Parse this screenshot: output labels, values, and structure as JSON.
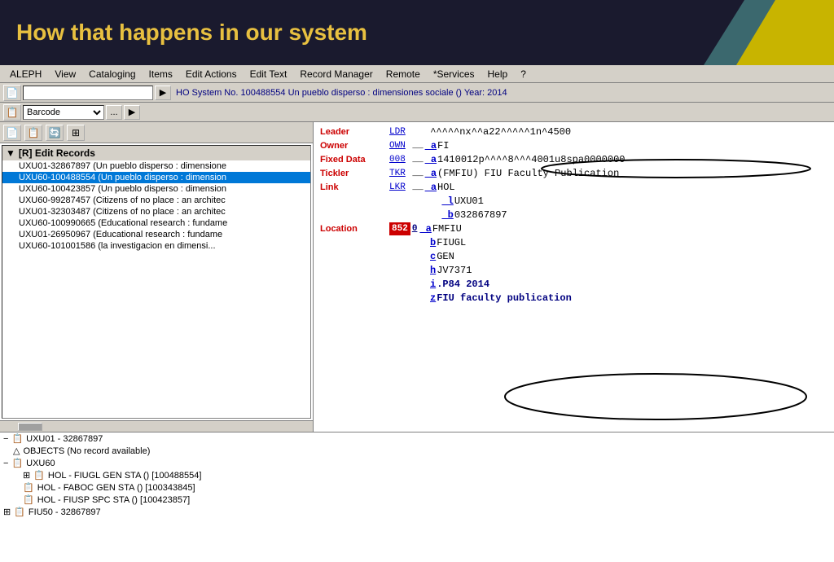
{
  "header": {
    "title": "How that happens in our system",
    "background_color": "#1a1a2e",
    "text_color": "#e8c040"
  },
  "menubar": {
    "items": [
      "ALEPH",
      "View",
      "Cataloging",
      "Items",
      "Edit Actions",
      "Edit Text",
      "Record Manager",
      "Remote",
      "*Services",
      "Help",
      "?"
    ]
  },
  "toolbar": {
    "nav_info": "HO System No. 100488554 Un pueblo disperso : dimensiones sociale () Year: 2014",
    "barcode_label": "Barcode"
  },
  "left_panel": {
    "tree_header": "[R] Edit Records",
    "tree_items": [
      "UXU01-32867897 (Un pueblo disperso : dimensione",
      "UXU60-100488554 (Un pueblo disperso : dimension",
      "UXU60-100423857 (Un pueblo disperso : dimension",
      "UXU60-99287457 (Citizens of no place : an architec",
      "UXU01-32303487 (Citizens of no place : an architec",
      "UXU60-100990665 (Educational research : fundame",
      "UXU01-26950967 (Educational research : fundame",
      "UXU60-101001586 (la investigacion en dimensi..."
    ]
  },
  "bottom_tree": {
    "items": [
      {
        "level": 0,
        "icon": "minus",
        "type": "book",
        "label": "UXU01 - 32867897"
      },
      {
        "level": 1,
        "icon": "triangle",
        "type": "objects",
        "label": "OBJECTS (No record available)"
      },
      {
        "level": 0,
        "icon": "minus",
        "type": "book",
        "label": "UXU60"
      },
      {
        "level": 1,
        "icon": "plus",
        "type": "book",
        "label": "HOL - FIUGL GEN STA () [100488554]"
      },
      {
        "level": 1,
        "icon": "plus",
        "type": "book",
        "label": "HOL - FABOC GEN STA () [100343845]"
      },
      {
        "level": 1,
        "icon": "plus",
        "type": "book",
        "label": "HOL - FIUSP SPC STA () [100423857]"
      },
      {
        "level": 0,
        "icon": "plus",
        "type": "book",
        "label": "FIU50 - 32867897"
      }
    ]
  },
  "right_panel": {
    "fields": [
      {
        "label": "Leader",
        "tag": "LDR",
        "ind": "",
        "subfields": [],
        "value": "^^^^^nx^^a22^^^^^1n^4500"
      },
      {
        "label": "Owner",
        "tag": "OWN",
        "ind": "__ a",
        "value": "FI"
      },
      {
        "label": "Fixed Data",
        "tag": "008",
        "ind": "__ a",
        "value": "1410012p^^^^8^^^4001u8spa0000000"
      },
      {
        "label": "Tickler",
        "tag": "TKR",
        "ind": "__ a",
        "value": "(FMFIU) FIU Faculty Publication",
        "oval": true
      },
      {
        "label": "Link",
        "tag": "LKR",
        "ind": "__ a",
        "value": "HOL",
        "sublines": [
          {
            "sub": "l",
            "val": "UXU01"
          },
          {
            "sub": "b",
            "val": "032867897"
          }
        ]
      },
      {
        "label": "Location",
        "tag": "852",
        "tag_box": "852",
        "ind0": "0",
        "sublines": [
          {
            "sub": "a",
            "val": "FMFIU"
          },
          {
            "sub": "b",
            "val": "FIUGL"
          },
          {
            "sub": "c",
            "val": "GEN"
          },
          {
            "sub": "h",
            "val": "JV7371"
          },
          {
            "sub": "i",
            "val": ".P84 2014",
            "oval": true
          },
          {
            "sub": "z",
            "val": "FIU faculty publication",
            "oval": true
          }
        ]
      }
    ]
  }
}
